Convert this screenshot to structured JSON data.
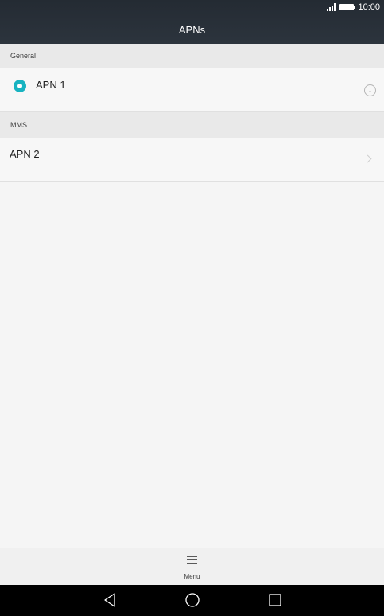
{
  "status_bar": {
    "time": "10:00",
    "icons": [
      "signal-icon",
      "battery-icon"
    ]
  },
  "header": {
    "title": "APNs"
  },
  "sections": [
    {
      "label": "General",
      "items": [
        {
          "label": "APN 1",
          "selected": true,
          "action_icon": "info-icon",
          "action_glyph": "i"
        }
      ]
    },
    {
      "label": "MMS",
      "items": [
        {
          "label": "APN 2",
          "action_icon": "chevron-right-icon"
        }
      ]
    }
  ],
  "menu_bar": {
    "menu_label": "Menu",
    "icon": "menu-icon"
  },
  "nav_bar": {
    "icons": [
      "back-icon",
      "home-icon",
      "recent-apps-icon"
    ]
  },
  "colors": {
    "header_bg": "#2c343d",
    "accent": "#18b3c1",
    "section_bg": "#e9e9e9",
    "row_bg": "#f7f7f7",
    "nav_bg": "#000000"
  }
}
